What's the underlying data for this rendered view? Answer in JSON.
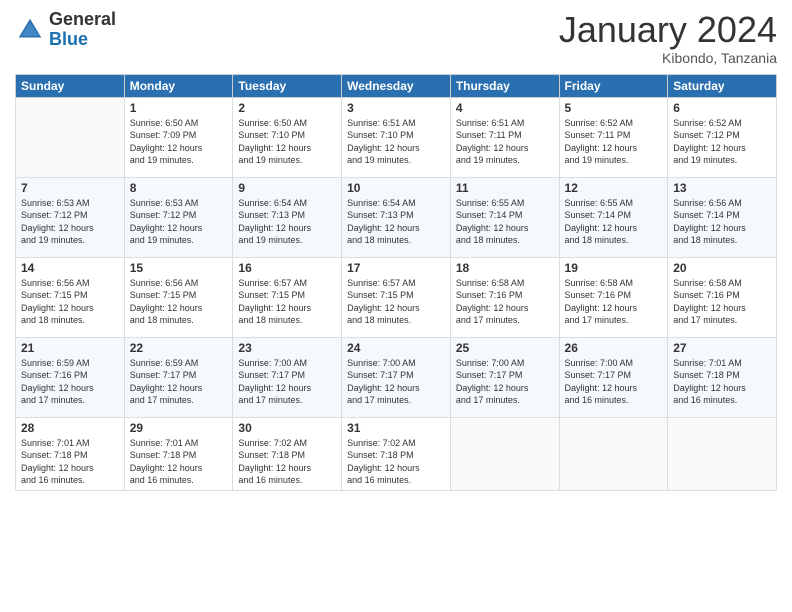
{
  "header": {
    "logo_general": "General",
    "logo_blue": "Blue",
    "month_title": "January 2024",
    "location": "Kibondo, Tanzania"
  },
  "days_of_week": [
    "Sunday",
    "Monday",
    "Tuesday",
    "Wednesday",
    "Thursday",
    "Friday",
    "Saturday"
  ],
  "weeks": [
    [
      {
        "day": "",
        "sunrise": "",
        "sunset": "",
        "daylight": ""
      },
      {
        "day": "1",
        "sunrise": "Sunrise: 6:50 AM",
        "sunset": "Sunset: 7:09 PM",
        "daylight": "Daylight: 12 hours and 19 minutes."
      },
      {
        "day": "2",
        "sunrise": "Sunrise: 6:50 AM",
        "sunset": "Sunset: 7:10 PM",
        "daylight": "Daylight: 12 hours and 19 minutes."
      },
      {
        "day": "3",
        "sunrise": "Sunrise: 6:51 AM",
        "sunset": "Sunset: 7:10 PM",
        "daylight": "Daylight: 12 hours and 19 minutes."
      },
      {
        "day": "4",
        "sunrise": "Sunrise: 6:51 AM",
        "sunset": "Sunset: 7:11 PM",
        "daylight": "Daylight: 12 hours and 19 minutes."
      },
      {
        "day": "5",
        "sunrise": "Sunrise: 6:52 AM",
        "sunset": "Sunset: 7:11 PM",
        "daylight": "Daylight: 12 hours and 19 minutes."
      },
      {
        "day": "6",
        "sunrise": "Sunrise: 6:52 AM",
        "sunset": "Sunset: 7:12 PM",
        "daylight": "Daylight: 12 hours and 19 minutes."
      }
    ],
    [
      {
        "day": "7",
        "sunrise": "Sunrise: 6:53 AM",
        "sunset": "Sunset: 7:12 PM",
        "daylight": "Daylight: 12 hours and 19 minutes."
      },
      {
        "day": "8",
        "sunrise": "Sunrise: 6:53 AM",
        "sunset": "Sunset: 7:12 PM",
        "daylight": "Daylight: 12 hours and 19 minutes."
      },
      {
        "day": "9",
        "sunrise": "Sunrise: 6:54 AM",
        "sunset": "Sunset: 7:13 PM",
        "daylight": "Daylight: 12 hours and 19 minutes."
      },
      {
        "day": "10",
        "sunrise": "Sunrise: 6:54 AM",
        "sunset": "Sunset: 7:13 PM",
        "daylight": "Daylight: 12 hours and 18 minutes."
      },
      {
        "day": "11",
        "sunrise": "Sunrise: 6:55 AM",
        "sunset": "Sunset: 7:14 PM",
        "daylight": "Daylight: 12 hours and 18 minutes."
      },
      {
        "day": "12",
        "sunrise": "Sunrise: 6:55 AM",
        "sunset": "Sunset: 7:14 PM",
        "daylight": "Daylight: 12 hours and 18 minutes."
      },
      {
        "day": "13",
        "sunrise": "Sunrise: 6:56 AM",
        "sunset": "Sunset: 7:14 PM",
        "daylight": "Daylight: 12 hours and 18 minutes."
      }
    ],
    [
      {
        "day": "14",
        "sunrise": "Sunrise: 6:56 AM",
        "sunset": "Sunset: 7:15 PM",
        "daylight": "Daylight: 12 hours and 18 minutes."
      },
      {
        "day": "15",
        "sunrise": "Sunrise: 6:56 AM",
        "sunset": "Sunset: 7:15 PM",
        "daylight": "Daylight: 12 hours and 18 minutes."
      },
      {
        "day": "16",
        "sunrise": "Sunrise: 6:57 AM",
        "sunset": "Sunset: 7:15 PM",
        "daylight": "Daylight: 12 hours and 18 minutes."
      },
      {
        "day": "17",
        "sunrise": "Sunrise: 6:57 AM",
        "sunset": "Sunset: 7:15 PM",
        "daylight": "Daylight: 12 hours and 18 minutes."
      },
      {
        "day": "18",
        "sunrise": "Sunrise: 6:58 AM",
        "sunset": "Sunset: 7:16 PM",
        "daylight": "Daylight: 12 hours and 17 minutes."
      },
      {
        "day": "19",
        "sunrise": "Sunrise: 6:58 AM",
        "sunset": "Sunset: 7:16 PM",
        "daylight": "Daylight: 12 hours and 17 minutes."
      },
      {
        "day": "20",
        "sunrise": "Sunrise: 6:58 AM",
        "sunset": "Sunset: 7:16 PM",
        "daylight": "Daylight: 12 hours and 17 minutes."
      }
    ],
    [
      {
        "day": "21",
        "sunrise": "Sunrise: 6:59 AM",
        "sunset": "Sunset: 7:16 PM",
        "daylight": "Daylight: 12 hours and 17 minutes."
      },
      {
        "day": "22",
        "sunrise": "Sunrise: 6:59 AM",
        "sunset": "Sunset: 7:17 PM",
        "daylight": "Daylight: 12 hours and 17 minutes."
      },
      {
        "day": "23",
        "sunrise": "Sunrise: 7:00 AM",
        "sunset": "Sunset: 7:17 PM",
        "daylight": "Daylight: 12 hours and 17 minutes."
      },
      {
        "day": "24",
        "sunrise": "Sunrise: 7:00 AM",
        "sunset": "Sunset: 7:17 PM",
        "daylight": "Daylight: 12 hours and 17 minutes."
      },
      {
        "day": "25",
        "sunrise": "Sunrise: 7:00 AM",
        "sunset": "Sunset: 7:17 PM",
        "daylight": "Daylight: 12 hours and 17 minutes."
      },
      {
        "day": "26",
        "sunrise": "Sunrise: 7:00 AM",
        "sunset": "Sunset: 7:17 PM",
        "daylight": "Daylight: 12 hours and 16 minutes."
      },
      {
        "day": "27",
        "sunrise": "Sunrise: 7:01 AM",
        "sunset": "Sunset: 7:18 PM",
        "daylight": "Daylight: 12 hours and 16 minutes."
      }
    ],
    [
      {
        "day": "28",
        "sunrise": "Sunrise: 7:01 AM",
        "sunset": "Sunset: 7:18 PM",
        "daylight": "Daylight: 12 hours and 16 minutes."
      },
      {
        "day": "29",
        "sunrise": "Sunrise: 7:01 AM",
        "sunset": "Sunset: 7:18 PM",
        "daylight": "Daylight: 12 hours and 16 minutes."
      },
      {
        "day": "30",
        "sunrise": "Sunrise: 7:02 AM",
        "sunset": "Sunset: 7:18 PM",
        "daylight": "Daylight: 12 hours and 16 minutes."
      },
      {
        "day": "31",
        "sunrise": "Sunrise: 7:02 AM",
        "sunset": "Sunset: 7:18 PM",
        "daylight": "Daylight: 12 hours and 16 minutes."
      },
      {
        "day": "",
        "sunrise": "",
        "sunset": "",
        "daylight": ""
      },
      {
        "day": "",
        "sunrise": "",
        "sunset": "",
        "daylight": ""
      },
      {
        "day": "",
        "sunrise": "",
        "sunset": "",
        "daylight": ""
      }
    ]
  ]
}
